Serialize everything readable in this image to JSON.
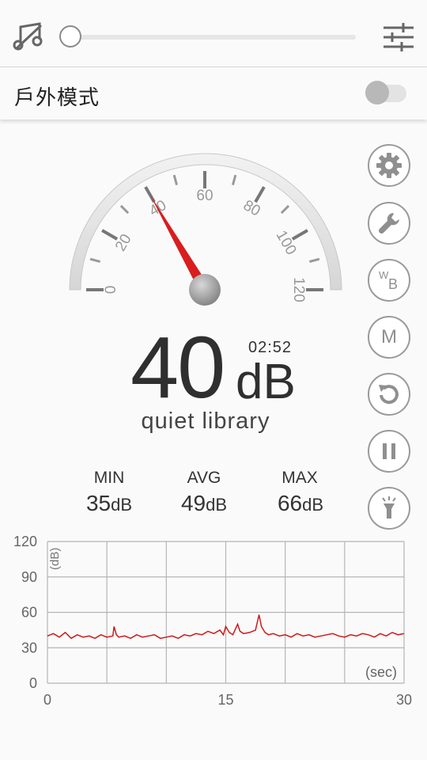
{
  "topbar": {
    "music_icon": "music-off-icon",
    "volume_level": 0.0,
    "settings_icon": "sliders-icon"
  },
  "outdoor": {
    "label": "戶外模式",
    "enabled": false
  },
  "gauge": {
    "ticks": [
      "0",
      "20",
      "40",
      "60",
      "80",
      "100",
      "120"
    ],
    "min": 0,
    "max": 120,
    "needle_value": 40
  },
  "reading": {
    "value": "40",
    "unit": "dB",
    "timer": "02:52",
    "description": "quiet library"
  },
  "stats": {
    "min_label": "MIN",
    "min_value": "35",
    "min_unit": "dB",
    "avg_label": "AVG",
    "avg_value": "49",
    "avg_unit": "dB",
    "max_label": "MAX",
    "max_value": "66",
    "max_unit": "dB"
  },
  "side_buttons": [
    {
      "name": "settings-button",
      "icon": "gear-icon"
    },
    {
      "name": "calibrate-button",
      "icon": "wrench-icon"
    },
    {
      "name": "weighting-button",
      "icon": "wb-icon",
      "text_w": "W",
      "text_b": "B"
    },
    {
      "name": "mode-button",
      "icon": "m-icon",
      "text": "M"
    },
    {
      "name": "reset-button",
      "icon": "reset-icon"
    },
    {
      "name": "pause-button",
      "icon": "pause-icon"
    },
    {
      "name": "flashlight-button",
      "icon": "flashlight-icon"
    }
  ],
  "chart_data": {
    "type": "line",
    "ylabel": "(dB)",
    "xlabel": "(sec)",
    "x_ticks": [
      "0",
      "15",
      "30"
    ],
    "y_ticks": [
      "120",
      "90",
      "60",
      "30",
      "0"
    ],
    "xlim": [
      0,
      30
    ],
    "ylim": [
      0,
      120
    ],
    "grid": true,
    "series": [
      {
        "color": "#cc1a1a",
        "x": [
          0,
          0.5,
          1,
          1.5,
          2,
          2.5,
          3,
          3.5,
          4,
          4.5,
          5,
          5.5,
          5.6,
          5.8,
          6,
          6.5,
          7,
          7.5,
          8,
          8.5,
          9,
          9.5,
          10,
          10.5,
          11,
          11.5,
          12,
          12.5,
          13,
          13.5,
          14,
          14.5,
          14.8,
          15,
          15.3,
          15.6,
          16,
          16.2,
          16.5,
          17,
          17.5,
          17.8,
          18,
          18.3,
          18.6,
          19,
          19.5,
          20,
          20.5,
          21,
          21.5,
          22,
          22.5,
          23,
          23.5,
          24,
          24.5,
          25,
          25.5,
          26,
          26.5,
          27,
          27.5,
          28,
          28.5,
          29,
          29.5,
          30
        ],
        "y": [
          40,
          42,
          39,
          43,
          38,
          41,
          39,
          40,
          38,
          41,
          39,
          40,
          48,
          41,
          39,
          40,
          38,
          41,
          39,
          40,
          41,
          38,
          39,
          40,
          38,
          41,
          40,
          42,
          41,
          44,
          42,
          45,
          41,
          48,
          43,
          41,
          50,
          44,
          42,
          43,
          45,
          58,
          48,
          43,
          41,
          42,
          40,
          41,
          39,
          42,
          40,
          41,
          39,
          40,
          41,
          42,
          40,
          39,
          41,
          40,
          42,
          41,
          39,
          42,
          40,
          43,
          41,
          42
        ]
      }
    ]
  }
}
